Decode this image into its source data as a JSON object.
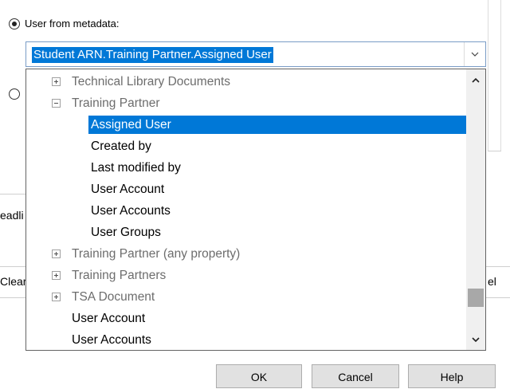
{
  "radio_group": {
    "user_from_metadata_label": "User from metadata:"
  },
  "combo": {
    "selected_value": "Student ARN.Training Partner.Assigned User"
  },
  "background": {
    "partial_left_label_1": "eadli",
    "partial_left_label_2": "Clear",
    "partial_right_label": "el"
  },
  "buttons": {
    "ok_label": "OK",
    "cancel_label": "Cancel",
    "help_label": "Help"
  },
  "tree": {
    "items": [
      {
        "label": "Technical Library Documents",
        "level": 0,
        "expander": "plus",
        "style": "gray"
      },
      {
        "label": "Training Partner",
        "level": 0,
        "expander": "minus",
        "style": "gray"
      },
      {
        "label": "Assigned User",
        "level": 1,
        "expander": "none",
        "style": "selected"
      },
      {
        "label": "Created by",
        "level": 1,
        "expander": "none",
        "style": "normal"
      },
      {
        "label": "Last modified by",
        "level": 1,
        "expander": "none",
        "style": "normal"
      },
      {
        "label": "User Account",
        "level": 1,
        "expander": "none",
        "style": "normal"
      },
      {
        "label": "User Accounts",
        "level": 1,
        "expander": "none",
        "style": "normal"
      },
      {
        "label": "User Groups",
        "level": 1,
        "expander": "none",
        "style": "normal"
      },
      {
        "label": "Training Partner (any property)",
        "level": 0,
        "expander": "plus",
        "style": "gray"
      },
      {
        "label": "Training Partners",
        "level": 0,
        "expander": "plus",
        "style": "gray"
      },
      {
        "label": "TSA Document",
        "level": 0,
        "expander": "plus",
        "style": "gray"
      },
      {
        "label": "User Account",
        "level": 0,
        "expander": "none",
        "style": "normal"
      },
      {
        "label": "User Accounts",
        "level": 0,
        "expander": "none",
        "style": "normal"
      }
    ]
  },
  "icons": {
    "combo_dropdown": "chevron-down-icon",
    "scroll_up": "chevron-up-icon",
    "scroll_down": "chevron-down-icon",
    "expand": "plus-box-icon",
    "collapse": "minus-box-icon"
  },
  "colors": {
    "selection": "#0078d7",
    "gray_text": "#6d6d6d"
  }
}
